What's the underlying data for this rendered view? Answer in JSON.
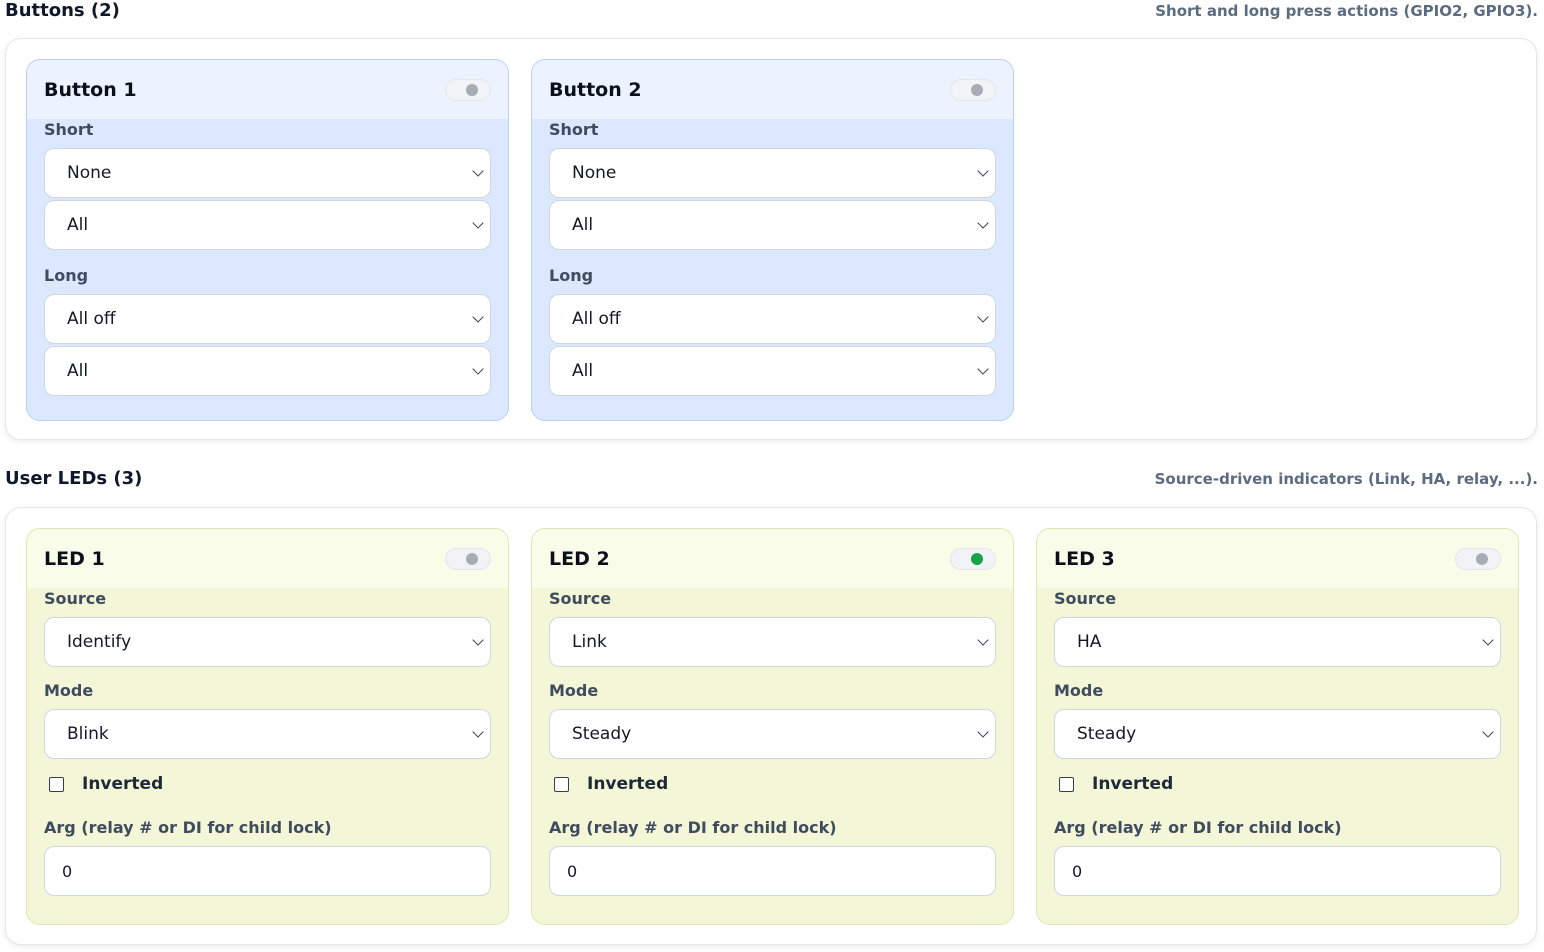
{
  "buttons_section": {
    "title": "Buttons (2)",
    "description": "Short and long press actions (GPIO2, GPIO3).",
    "cards": [
      {
        "title": "Button 1",
        "enabled": false,
        "short_label": "Short",
        "short_action": "None",
        "short_target": "All",
        "long_label": "Long",
        "long_action": "All off",
        "long_target": "All"
      },
      {
        "title": "Button 2",
        "enabled": false,
        "short_label": "Short",
        "short_action": "None",
        "short_target": "All",
        "long_label": "Long",
        "long_action": "All off",
        "long_target": "All"
      }
    ]
  },
  "leds_section": {
    "title": "User LEDs (3)",
    "description": "Source-driven indicators (Link, HA, relay, ...).",
    "cards": [
      {
        "title": "LED 1",
        "enabled": false,
        "source_label": "Source",
        "source": "Identify",
        "mode_label": "Mode",
        "mode": "Blink",
        "inverted_label": "Inverted",
        "inverted": false,
        "arg_label": "Arg (relay # or DI for child lock)",
        "arg": "0"
      },
      {
        "title": "LED 2",
        "enabled": true,
        "source_label": "Source",
        "source": "Link",
        "mode_label": "Mode",
        "mode": "Steady",
        "inverted_label": "Inverted",
        "inverted": false,
        "arg_label": "Arg (relay # or DI for child lock)",
        "arg": "0"
      },
      {
        "title": "LED 3",
        "enabled": false,
        "source_label": "Source",
        "source": "HA",
        "mode_label": "Mode",
        "mode": "Steady",
        "inverted_label": "Inverted",
        "inverted": false,
        "arg_label": "Arg (relay # or DI for child lock)",
        "arg": "0"
      }
    ]
  },
  "colors": {
    "toggle_on": "#16a34a",
    "toggle_off": "#a8adb5",
    "button_card_bg": "#dbe8fd",
    "led_card_bg": "#f3f7d7"
  }
}
